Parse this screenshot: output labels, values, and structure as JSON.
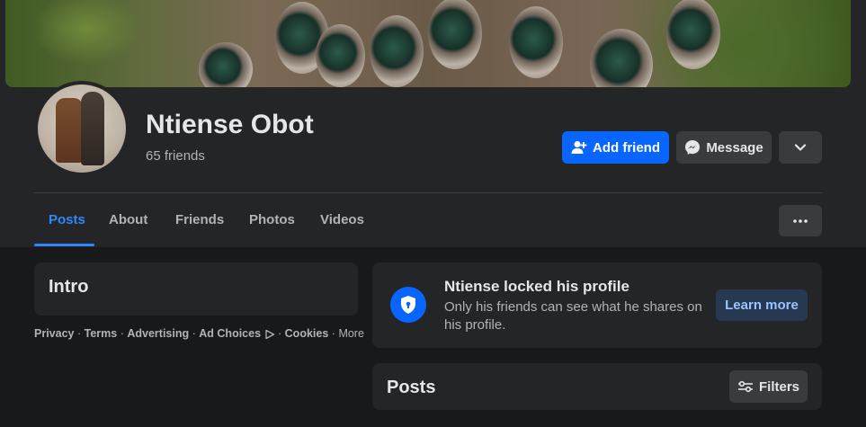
{
  "profile": {
    "name": "Ntiense Obot",
    "friends": "65 friends"
  },
  "actions": {
    "add_friend": "Add friend",
    "message": "Message"
  },
  "tabs": [
    {
      "label": "Posts",
      "active": true
    },
    {
      "label": "About",
      "active": false
    },
    {
      "label": "Friends",
      "active": false
    },
    {
      "label": "Photos",
      "active": false
    },
    {
      "label": "Videos",
      "active": false
    }
  ],
  "intro": {
    "title": "Intro"
  },
  "footer": {
    "privacy": "Privacy",
    "terms": "Terms",
    "advertising": "Advertising",
    "ad_choices": "Ad Choices",
    "cookies": "Cookies",
    "more": "More"
  },
  "locked": {
    "title": "Ntiense locked his profile",
    "description": "Only his friends can see what he shares on his profile.",
    "learn_more": "Learn more"
  },
  "posts": {
    "title": "Posts",
    "filters": "Filters"
  },
  "colors": {
    "accent": "#0866ff",
    "active_tab": "#2d88ff",
    "background": "#18191a",
    "card": "#242526"
  },
  "icons": {
    "add_friend": "person-plus-icon",
    "message": "messenger-icon",
    "dropdown": "chevron-down-icon",
    "more": "ellipsis-icon",
    "lock": "shield-lock-icon",
    "filters": "sliders-icon",
    "ad_choices": "ad-choices-icon"
  }
}
